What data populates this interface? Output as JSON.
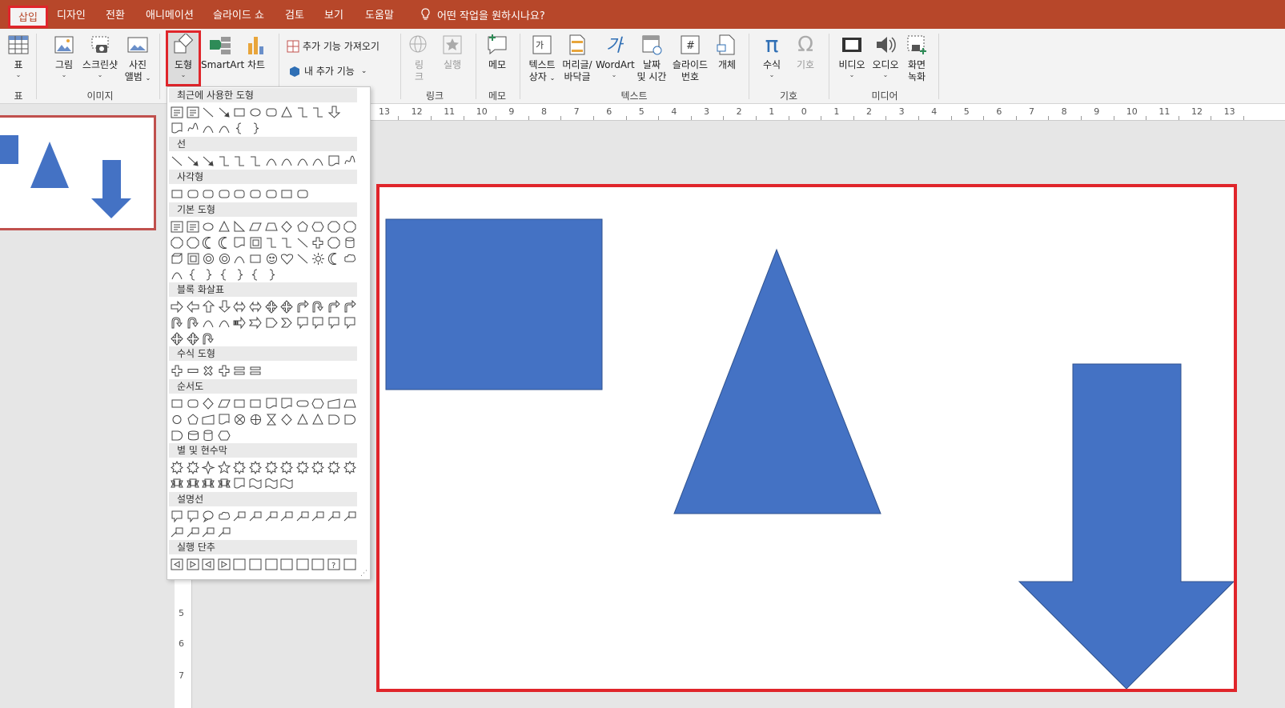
{
  "menu": {
    "tabs": [
      {
        "label": "삽입",
        "active": true
      },
      {
        "label": "디자인"
      },
      {
        "label": "전환"
      },
      {
        "label": "애니메이션"
      },
      {
        "label": "슬라이드 쇼"
      },
      {
        "label": "검토"
      },
      {
        "label": "보기"
      },
      {
        "label": "도움말"
      }
    ],
    "tell_me": "어떤 작업을 원하시나요?"
  },
  "ribbon": {
    "table": {
      "label": "표",
      "group": "표"
    },
    "images": {
      "picture": "그림",
      "screenshot": "스크린샷",
      "album_l1": "사진",
      "album_l2": "앨범",
      "group": "이미지"
    },
    "shapes": "도형",
    "smartart": "SmartArt",
    "chart": "차트",
    "addins": {
      "get": "추가 기능 가져오기",
      "my": "내 추가 기능"
    },
    "links": {
      "link": "링크",
      "action": "실행",
      "group": "링크"
    },
    "comment": {
      "label": "메모",
      "group": "메모"
    },
    "text": {
      "textbox_l1": "텍스트",
      "textbox_l2": "상자",
      "header_l1": "머리글/",
      "header_l2": "바닥글",
      "wordart": "WordArt",
      "date_l1": "날짜",
      "date_l2": "및 시간",
      "slidenum_l1": "슬라이드",
      "slidenum_l2": "번호",
      "object": "개체",
      "group": "텍스트"
    },
    "symbols": {
      "equation": "수식",
      "symbol": "기호",
      "group": "기호"
    },
    "media": {
      "video": "비디오",
      "audio": "오디오",
      "screen_l1": "화면",
      "screen_l2": "녹화",
      "group": "미디어"
    }
  },
  "ruler_ticks": [
    "13",
    "12",
    "11",
    "10",
    "9",
    "8",
    "7",
    "6",
    "5",
    "4",
    "3",
    "2",
    "1",
    "0",
    "1",
    "2",
    "3",
    "4",
    "5",
    "6",
    "7",
    "8",
    "9",
    "10",
    "11",
    "12",
    "13"
  ],
  "vruler_ticks": [
    "5",
    "6",
    "7"
  ],
  "shapes_menu": {
    "categories": [
      "최근에 사용한 도형",
      "선",
      "사각형",
      "기본 도형",
      "블록 화살표",
      "수식 도형",
      "순서도",
      "별 및 현수막",
      "설명선",
      "실행 단추"
    ]
  },
  "colors": {
    "accent": "#b7472a",
    "shape_fill": "#4472c4",
    "highlight": "#e0252b"
  }
}
